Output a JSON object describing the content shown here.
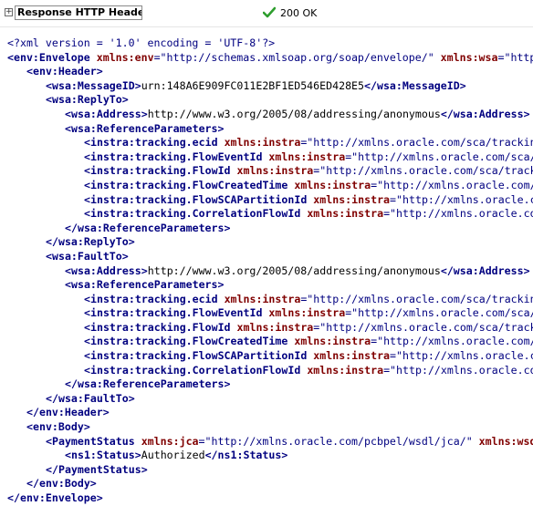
{
  "header": {
    "expander_symbol": "+",
    "title": "Response HTTP Headers",
    "status_icon": "check-icon",
    "status_text": "200 OK",
    "status_color": "#2e9e2e"
  },
  "xml": {
    "lines": [
      {
        "indent": 0,
        "parts": [
          {
            "c": "pi",
            "t": "<?xml version = '1.0' encoding = 'UTF-8'?>"
          }
        ]
      },
      {
        "indent": 0,
        "parts": [
          {
            "c": "tag",
            "t": "<env:Envelope "
          },
          {
            "c": "ns",
            "t": "xmlns:env"
          },
          {
            "c": "val",
            "t": "=\"http://schemas.xmlsoap.org/soap/envelope/\" "
          },
          {
            "c": "ns",
            "t": "xmlns:wsa"
          },
          {
            "c": "val",
            "t": "=\"http"
          }
        ]
      },
      {
        "indent": 1,
        "parts": [
          {
            "c": "tag",
            "t": "<env:Header>"
          }
        ]
      },
      {
        "indent": 2,
        "parts": [
          {
            "c": "tag",
            "t": "<wsa:MessageID>"
          },
          {
            "c": "txt",
            "t": "urn:148A6E909FC011E2BF1ED546ED428E5"
          },
          {
            "c": "tag",
            "t": "</wsa:MessageID>"
          }
        ]
      },
      {
        "indent": 2,
        "parts": [
          {
            "c": "tag",
            "t": "<wsa:ReplyTo>"
          }
        ]
      },
      {
        "indent": 3,
        "parts": [
          {
            "c": "tag",
            "t": "<wsa:Address>"
          },
          {
            "c": "txt",
            "t": "http://www.w3.org/2005/08/addressing/anonymous"
          },
          {
            "c": "tag",
            "t": "</wsa:Address>"
          }
        ]
      },
      {
        "indent": 3,
        "parts": [
          {
            "c": "tag",
            "t": "<wsa:ReferenceParameters>"
          }
        ]
      },
      {
        "indent": 4,
        "parts": [
          {
            "c": "tag",
            "t": "<instra:tracking.ecid "
          },
          {
            "c": "ns",
            "t": "xmlns:instra"
          },
          {
            "c": "val",
            "t": "=\"http://xmlns.oracle.com/sca/trackin"
          }
        ]
      },
      {
        "indent": 4,
        "parts": [
          {
            "c": "tag",
            "t": "<instra:tracking.FlowEventId "
          },
          {
            "c": "ns",
            "t": "xmlns:instra"
          },
          {
            "c": "val",
            "t": "=\"http://xmlns.oracle.com/sca/"
          }
        ]
      },
      {
        "indent": 4,
        "parts": [
          {
            "c": "tag",
            "t": "<instra:tracking.FlowId "
          },
          {
            "c": "ns",
            "t": "xmlns:instra"
          },
          {
            "c": "val",
            "t": "=\"http://xmlns.oracle.com/sca/track"
          }
        ]
      },
      {
        "indent": 4,
        "parts": [
          {
            "c": "tag",
            "t": "<instra:tracking.FlowCreatedTime "
          },
          {
            "c": "ns",
            "t": "xmlns:instra"
          },
          {
            "c": "val",
            "t": "=\"http://xmlns.oracle.com/"
          }
        ]
      },
      {
        "indent": 4,
        "parts": [
          {
            "c": "tag",
            "t": "<instra:tracking.FlowSCAPartitionId "
          },
          {
            "c": "ns",
            "t": "xmlns:instra"
          },
          {
            "c": "val",
            "t": "=\"http://xmlns.oracle.c"
          }
        ]
      },
      {
        "indent": 4,
        "parts": [
          {
            "c": "tag",
            "t": "<instra:tracking.CorrelationFlowId "
          },
          {
            "c": "ns",
            "t": "xmlns:instra"
          },
          {
            "c": "val",
            "t": "=\"http://xmlns.oracle.co"
          }
        ]
      },
      {
        "indent": 3,
        "parts": [
          {
            "c": "tag",
            "t": "</wsa:ReferenceParameters>"
          }
        ]
      },
      {
        "indent": 2,
        "parts": [
          {
            "c": "tag",
            "t": "</wsa:ReplyTo>"
          }
        ]
      },
      {
        "indent": 2,
        "parts": [
          {
            "c": "tag",
            "t": "<wsa:FaultTo>"
          }
        ]
      },
      {
        "indent": 3,
        "parts": [
          {
            "c": "tag",
            "t": "<wsa:Address>"
          },
          {
            "c": "txt",
            "t": "http://www.w3.org/2005/08/addressing/anonymous"
          },
          {
            "c": "tag",
            "t": "</wsa:Address>"
          }
        ]
      },
      {
        "indent": 3,
        "parts": [
          {
            "c": "tag",
            "t": "<wsa:ReferenceParameters>"
          }
        ]
      },
      {
        "indent": 4,
        "parts": [
          {
            "c": "tag",
            "t": "<instra:tracking.ecid "
          },
          {
            "c": "ns",
            "t": "xmlns:instra"
          },
          {
            "c": "val",
            "t": "=\"http://xmlns.oracle.com/sca/trackin"
          }
        ]
      },
      {
        "indent": 4,
        "parts": [
          {
            "c": "tag",
            "t": "<instra:tracking.FlowEventId "
          },
          {
            "c": "ns",
            "t": "xmlns:instra"
          },
          {
            "c": "val",
            "t": "=\"http://xmlns.oracle.com/sca/"
          }
        ]
      },
      {
        "indent": 4,
        "parts": [
          {
            "c": "tag",
            "t": "<instra:tracking.FlowId "
          },
          {
            "c": "ns",
            "t": "xmlns:instra"
          },
          {
            "c": "val",
            "t": "=\"http://xmlns.oracle.com/sca/track"
          }
        ]
      },
      {
        "indent": 4,
        "parts": [
          {
            "c": "tag",
            "t": "<instra:tracking.FlowCreatedTime "
          },
          {
            "c": "ns",
            "t": "xmlns:instra"
          },
          {
            "c": "val",
            "t": "=\"http://xmlns.oracle.com/"
          }
        ]
      },
      {
        "indent": 4,
        "parts": [
          {
            "c": "tag",
            "t": "<instra:tracking.FlowSCAPartitionId "
          },
          {
            "c": "ns",
            "t": "xmlns:instra"
          },
          {
            "c": "val",
            "t": "=\"http://xmlns.oracle.c"
          }
        ]
      },
      {
        "indent": 4,
        "parts": [
          {
            "c": "tag",
            "t": "<instra:tracking.CorrelationFlowId "
          },
          {
            "c": "ns",
            "t": "xmlns:instra"
          },
          {
            "c": "val",
            "t": "=\"http://xmlns.oracle.co"
          }
        ]
      },
      {
        "indent": 3,
        "parts": [
          {
            "c": "tag",
            "t": "</wsa:ReferenceParameters>"
          }
        ]
      },
      {
        "indent": 2,
        "parts": [
          {
            "c": "tag",
            "t": "</wsa:FaultTo>"
          }
        ]
      },
      {
        "indent": 1,
        "parts": [
          {
            "c": "tag",
            "t": "</env:Header>"
          }
        ]
      },
      {
        "indent": 1,
        "parts": [
          {
            "c": "tag",
            "t": "<env:Body>"
          }
        ]
      },
      {
        "indent": 2,
        "parts": [
          {
            "c": "tag",
            "t": "<PaymentStatus "
          },
          {
            "c": "ns",
            "t": "xmlns:jca"
          },
          {
            "c": "val",
            "t": "=\"http://xmlns.oracle.com/pcbpel/wsdl/jca/\" "
          },
          {
            "c": "ns",
            "t": "xmlns:wsd"
          }
        ]
      },
      {
        "indent": 3,
        "parts": [
          {
            "c": "tag",
            "t": "<ns1:Status>"
          },
          {
            "c": "txt",
            "t": "Authorized"
          },
          {
            "c": "tag",
            "t": "</ns1:Status>"
          }
        ]
      },
      {
        "indent": 2,
        "parts": [
          {
            "c": "tag",
            "t": "</PaymentStatus>"
          }
        ]
      },
      {
        "indent": 1,
        "parts": [
          {
            "c": "tag",
            "t": "</env:Body>"
          }
        ]
      },
      {
        "indent": 0,
        "parts": [
          {
            "c": "tag",
            "t": "</env:Envelope>"
          }
        ]
      }
    ]
  }
}
